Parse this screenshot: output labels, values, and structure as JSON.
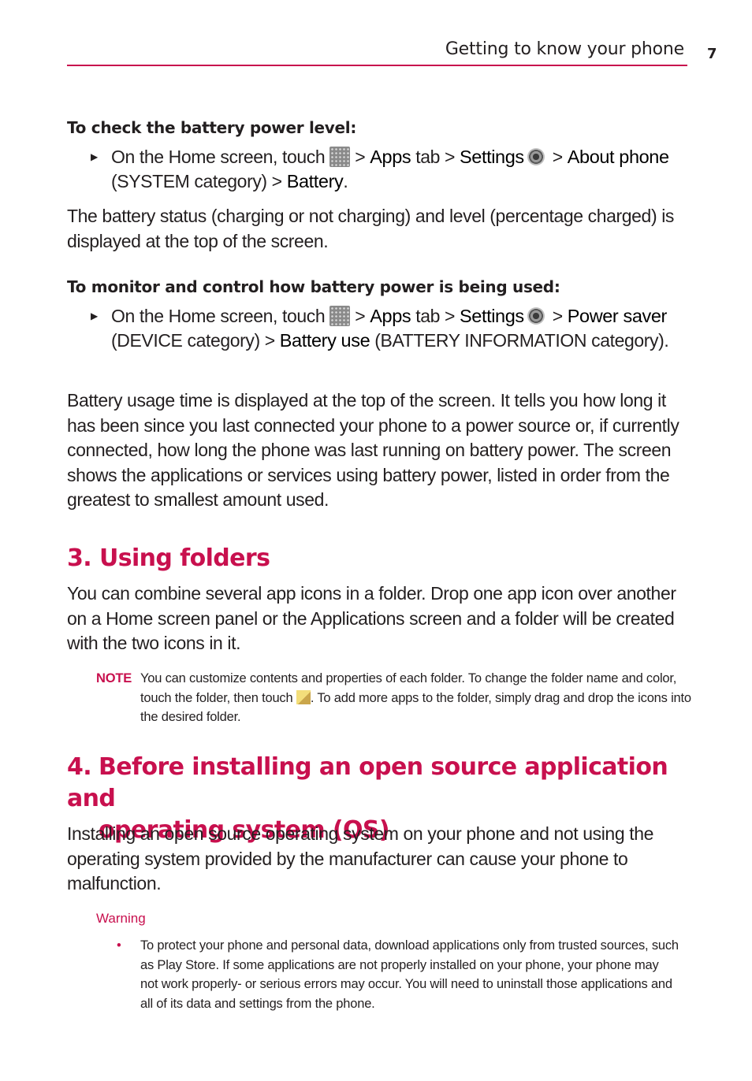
{
  "header": {
    "title": "Getting to know your phone",
    "page_number": "7",
    "accent_color": "#c8104e"
  },
  "battery_level": {
    "heading": "To check the battery power level:",
    "step": {
      "t1": "On the Home screen, touch ",
      "apps_icon": "apps-grid-icon",
      "t2": " > ",
      "b1": "Apps",
      "t3": " tab > ",
      "b2": "Settings",
      "settings_icon": "settings-gear-icon",
      "t4": " > ",
      "b3": "About phone",
      "t5": " (SYSTEM category) > ",
      "b4": "Battery",
      "t6": "."
    },
    "paragraph": "The battery status (charging or not charging) and level (percentage charged) is displayed at the top of the screen."
  },
  "battery_use": {
    "heading": "To monitor and control how battery power is being used:",
    "step": {
      "t1": "On the Home screen, touch ",
      "t2": " > ",
      "b1": "Apps",
      "t3": " tab > ",
      "b2": "Settings",
      "t4": " > ",
      "b3": "Power saver",
      "t5": " (DEVICE category) > ",
      "b4": "Battery use",
      "t6": " (BATTERY INFORMATION category)."
    },
    "paragraph": "Battery usage time is displayed at the top of the screen. It tells you how long it has been since you last connected your phone to a power source or, if currently connected, how long the phone was last running on battery power. The screen shows the applications or services using battery power, listed in order from the greatest to smallest amount used."
  },
  "section3": {
    "number": "3.",
    "title": "Using folders",
    "paragraph": "You can combine several app icons in a folder. Drop one app icon over another on a Home screen panel or the Applications screen and a folder will be created with the two icons in it.",
    "note": {
      "label": "NOTE",
      "t1": "You can customize contents and properties of each folder. To change the folder name and color, touch the folder, then touch ",
      "icon": "edit-folder-icon",
      "t2": ". To add more apps to the folder, simply drag and drop the icons into the desired folder."
    }
  },
  "section4": {
    "number": "4.",
    "title_line1": "Before installing an open source application and",
    "title_line2": "operating system (OS)",
    "paragraph": "Installing an open source operating system on your phone and not using the operating system provided by the manufacturer can cause your phone to malfunction.",
    "warning_label": "Warning",
    "warning_items": [
      "To protect your phone and personal data, download applications only from trusted sources, such as Play Store. If some applications are not properly installed on your phone, your phone may not work properly- or serious errors may occur. You will need to uninstall those applications and all of its data and settings from the phone."
    ]
  }
}
